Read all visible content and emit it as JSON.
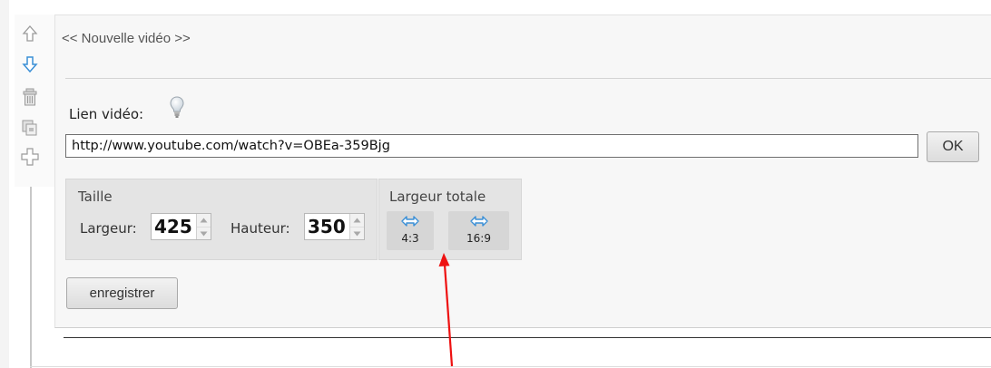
{
  "block": {
    "title": "<< Nouvelle vidéo >>"
  },
  "toolbar": {
    "icons": [
      "move-up-icon",
      "move-down-icon",
      "trash-icon",
      "copy-icon",
      "add-icon"
    ]
  },
  "video": {
    "link_label": "Lien vidéo:",
    "url": "http://www.youtube.com/watch?v=OBEa-359Bjg",
    "ok_label": "OK"
  },
  "size": {
    "section_label": "Taille",
    "width_label": "Largeur:",
    "width_value": "425",
    "height_label": "Hauteur:",
    "height_value": "350"
  },
  "full_width": {
    "section_label": "Largeur totale",
    "ratio_4_3": "4:3",
    "ratio_16_9": "16:9"
  },
  "actions": {
    "save_label": "enregistrer"
  },
  "colors": {
    "accent_blue": "#3a8fd6",
    "annotation_red": "#ee1111"
  }
}
